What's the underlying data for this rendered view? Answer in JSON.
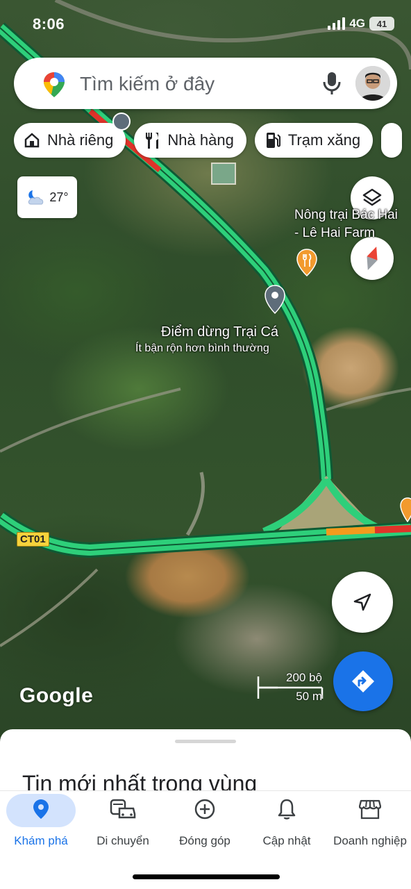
{
  "status_bar": {
    "time": "8:06",
    "network": "4G",
    "battery": "41"
  },
  "search": {
    "placeholder": "Tìm kiếm ở đây",
    "icons": [
      "google-maps-pin-icon",
      "mic-icon",
      "avatar"
    ]
  },
  "chips": [
    {
      "label": "Nhà riêng",
      "icon": "home-icon"
    },
    {
      "label": "Nhà hàng",
      "icon": "restaurant-icon"
    },
    {
      "label": "Trạm xăng",
      "icon": "gas-station-icon"
    }
  ],
  "weather": {
    "temperature": "27°",
    "icon": "partly-cloudy-night-icon"
  },
  "map": {
    "poi_farm": "Nông trại Bác Hai\n- Lê Hai Farm",
    "poi_stop_name": "Điểm dừng Trại Cá",
    "poi_stop_status": "Ít bận rộn hơn bình thường",
    "route_shield": "CT01",
    "logo": "Google",
    "scale_imperial": "200 bộ",
    "scale_metric": "50 m",
    "colors": {
      "traffic_green": "#2ecf7a",
      "traffic_orange": "#f39b1d",
      "traffic_red": "#e0332a",
      "accent_blue": "#1a73e8"
    }
  },
  "sheet": {
    "title": "Tin mới nhất trong vùng"
  },
  "nav": [
    {
      "label": "Khám phá",
      "icon": "explore-pin-icon",
      "active": true
    },
    {
      "label": "Di chuyển",
      "icon": "commute-icon",
      "active": false
    },
    {
      "label": "Đóng góp",
      "icon": "add-circle-icon",
      "active": false
    },
    {
      "label": "Cập nhật",
      "icon": "bell-icon",
      "active": false
    },
    {
      "label": "Doanh nghiệp",
      "icon": "storefront-icon",
      "active": false
    }
  ]
}
